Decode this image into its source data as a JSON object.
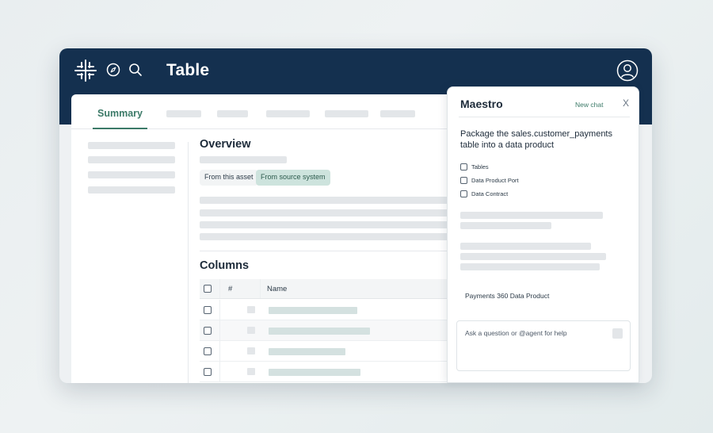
{
  "header": {
    "title": "Table",
    "icons": [
      "logo-icon",
      "compass-icon",
      "search-icon",
      "user-icon"
    ]
  },
  "tabs": {
    "active_label": "Summary"
  },
  "overview": {
    "heading": "Overview",
    "chip_asset": "From this asset",
    "chip_source": "From source system"
  },
  "columns": {
    "heading": "Columns",
    "headers": {
      "index": "#",
      "name": "Name"
    }
  },
  "chat": {
    "title": "Maestro",
    "new_chat": "New chat",
    "close": "X",
    "prompt": "Package the sales.customer_payments table into a data product",
    "options": [
      "Tables",
      "Data Product Port",
      "Data Contract"
    ],
    "product_name": "Payments 360 Data Product",
    "input_placeholder": "Ask a question or @agent for help"
  },
  "colors": {
    "header_bg": "#14304f",
    "accent": "#3c7a68",
    "chip_active": "#cde3dd"
  }
}
